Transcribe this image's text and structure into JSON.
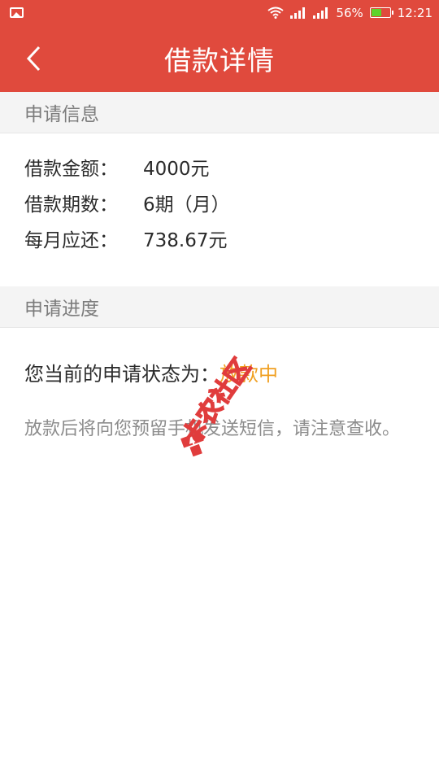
{
  "status_bar": {
    "battery_percent": "56%",
    "time": "12:21",
    "battery_level": 0.56,
    "icons": [
      "gallery-icon",
      "wifi-icon",
      "signal-icon",
      "signal-icon",
      "battery-icon"
    ]
  },
  "header": {
    "title": "借款详情",
    "back_icon": "chevron-left-icon",
    "color": "#e04a3d"
  },
  "application_info": {
    "section_title": "申请信息",
    "rows": [
      {
        "label": "借款金额：",
        "value": "4000元"
      },
      {
        "label": "借款期数：",
        "value": "6期（月）"
      },
      {
        "label": "每月应还：",
        "value": "738.67元"
      }
    ]
  },
  "progress": {
    "section_title": "申请进度",
    "status_label": "您当前的申请状态为：",
    "status_value": "放款中",
    "status_color": "#f0a022",
    "note": "放款后将向您预留手机发送短信，请注意查收。"
  },
  "watermark": {
    "text": "卡农社区"
  }
}
